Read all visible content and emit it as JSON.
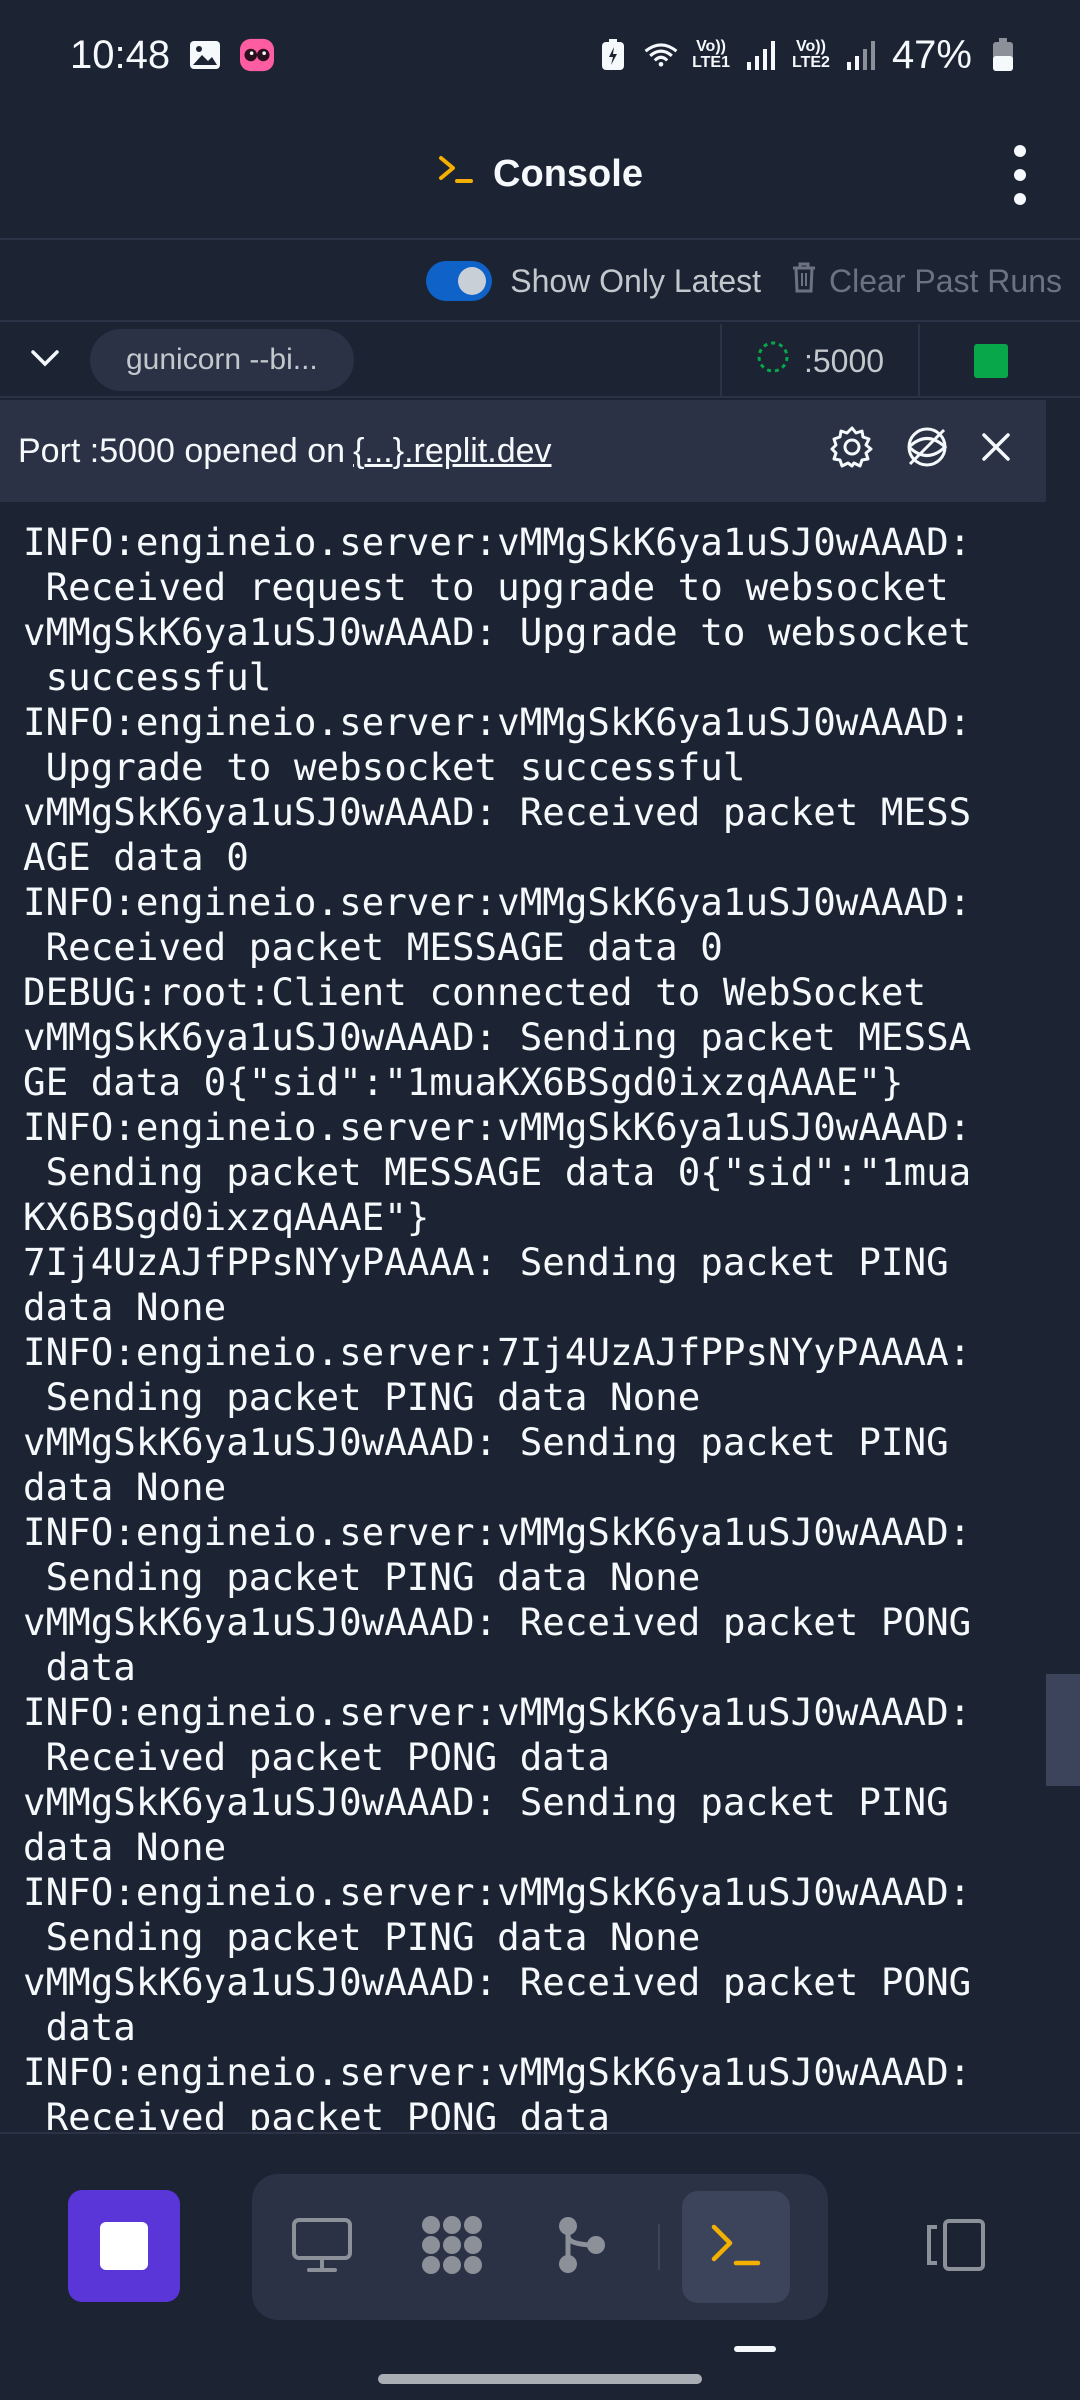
{
  "status_bar": {
    "time": "10:48",
    "battery": "47%",
    "net_lte1": "LTE1",
    "net_lte2": "LTE2",
    "vo1": "Vo))",
    "vo2": "Vo))"
  },
  "header": {
    "title": "Console"
  },
  "toolbar": {
    "toggle_label": "Show Only Latest",
    "toggle_on": true,
    "clear_label": "Clear Past Runs"
  },
  "run": {
    "command": "gunicorn --bi...",
    "port": ":5000",
    "status_color": "#08a84a"
  },
  "port_banner": {
    "text": "Port :5000 opened on",
    "link": "{...}.replit.dev"
  },
  "console": {
    "lines": [
      "INFO:engineio.server:vMMgSkK6ya1uSJ0wAAAD:",
      " Received request to upgrade to websocket",
      "vMMgSkK6ya1uSJ0wAAAD: Upgrade to websocket",
      " successful",
      "INFO:engineio.server:vMMgSkK6ya1uSJ0wAAAD:",
      " Upgrade to websocket successful",
      "vMMgSkK6ya1uSJ0wAAAD: Received packet MESS",
      "AGE data 0",
      "INFO:engineio.server:vMMgSkK6ya1uSJ0wAAAD:",
      " Received packet MESSAGE data 0",
      "DEBUG:root:Client connected to WebSocket",
      "vMMgSkK6ya1uSJ0wAAAD: Sending packet MESSA",
      "GE data 0{\"sid\":\"1muaKX6BSgd0ixzqAAAE\"}",
      "INFO:engineio.server:vMMgSkK6ya1uSJ0wAAAD:",
      " Sending packet MESSAGE data 0{\"sid\":\"1mua",
      "KX6BSgd0ixzqAAAE\"}",
      "7Ij4UzAJfPPsNYyPAAAA: Sending packet PING",
      "data None",
      "INFO:engineio.server:7Ij4UzAJfPPsNYyPAAAA:",
      " Sending packet PING data None",
      "vMMgSkK6ya1uSJ0wAAAD: Sending packet PING",
      "data None",
      "INFO:engineio.server:vMMgSkK6ya1uSJ0wAAAD:",
      " Sending packet PING data None",
      "vMMgSkK6ya1uSJ0wAAAD: Received packet PONG",
      " data",
      "INFO:engineio.server:vMMgSkK6ya1uSJ0wAAAD:",
      " Received packet PONG data",
      "vMMgSkK6ya1uSJ0wAAAD: Sending packet PING",
      "data None",
      "INFO:engineio.server:vMMgSkK6ya1uSJ0wAAAD:",
      " Sending packet PING data None",
      "vMMgSkK6ya1uSJ0wAAAD: Received packet PONG",
      " data",
      "INFO:engineio.server:vMMgSkK6ya1uSJ0wAAAD:",
      " Received packet PONG data"
    ]
  },
  "bottom_nav": {
    "accent": "#5a36d9",
    "items": [
      {
        "icon": "webview-icon",
        "active": false
      },
      {
        "icon": "packages-icon",
        "active": false
      },
      {
        "icon": "git-icon",
        "active": false
      },
      {
        "icon": "console-icon",
        "active": true
      }
    ]
  }
}
